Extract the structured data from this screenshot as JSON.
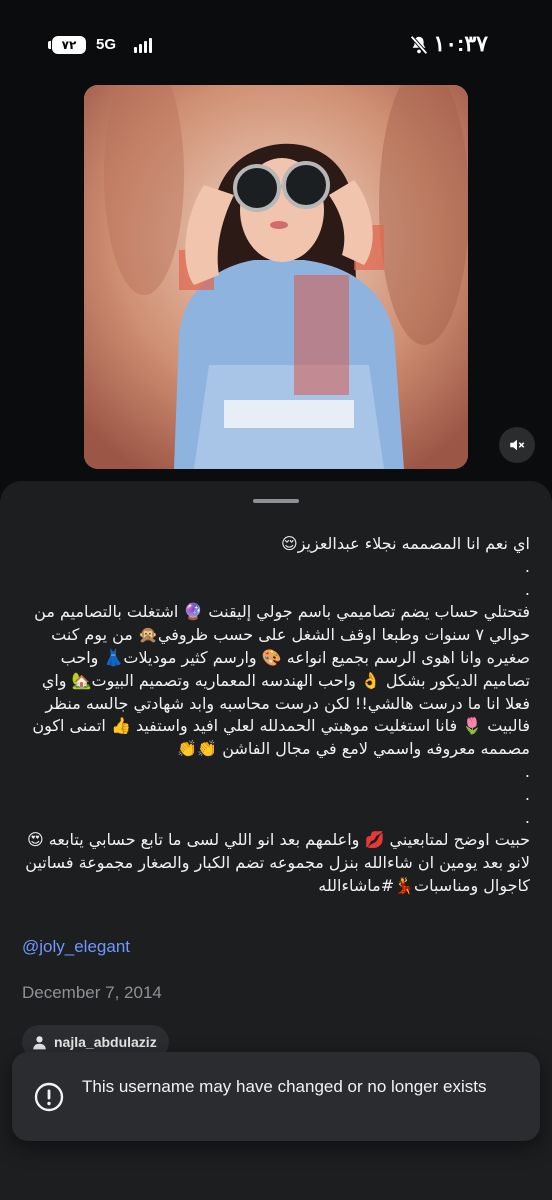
{
  "status_bar": {
    "battery": "٧٢",
    "network": "5G",
    "time": "١٠:٣٧"
  },
  "post": {
    "caption": "اي نعم انا المصممه نجلاء عبدالعزيز😌\n.\n.\nفتحتلي حساب يضم تصاميمي باسم جولي إليقنت 🔮 اشتغلت بالتصاميم من حوالي ٧ سنوات وطبعا اوقف الشغل على حسب ظروفي🙊 من يوم كنت صغيره وانا اهوى الرسم بجميع انواعه 🎨 وارسم كثير موديلات👗 واحب تصاميم الديكور بشكل 👌 واحب الهندسه المعماريه وتصميم البيوت🏡 واي فعلا انا ما درست هالشي!! لكن درست محاسبه وابد شهادتي جالسه منظر فالبيت 🌷 فانا استغليت موهبتي الحمدلله لعلي افيد واستفيد 👍 اتمنى اكون مصممه معروفه واسمي لامع في مجال الفاشن 👏👏\n.\n.\n.\nحبيت اوضح لمتابعيني 💋 واعلمهم بعد انو اللي لسى ما تابع حسابي يتابعه 😍 لانو بعد يومين ان شاءالله بنزل مجموعه تضم الكبار والصغار مجموعة فساتين كاجوال ومناسبات💃#ماشاءالله",
    "tag": "@joly_elegant",
    "date": "December 7, 2014",
    "username": "najla_abdulaziz"
  },
  "toast": {
    "message": "This username may have changed or no longer exists",
    "icon": "exclamation-circle-icon"
  },
  "colors": {
    "background": "#0b0c0d",
    "sheet": "#1c1e20",
    "link": "#6e98ff",
    "muted": "#8e9196"
  }
}
